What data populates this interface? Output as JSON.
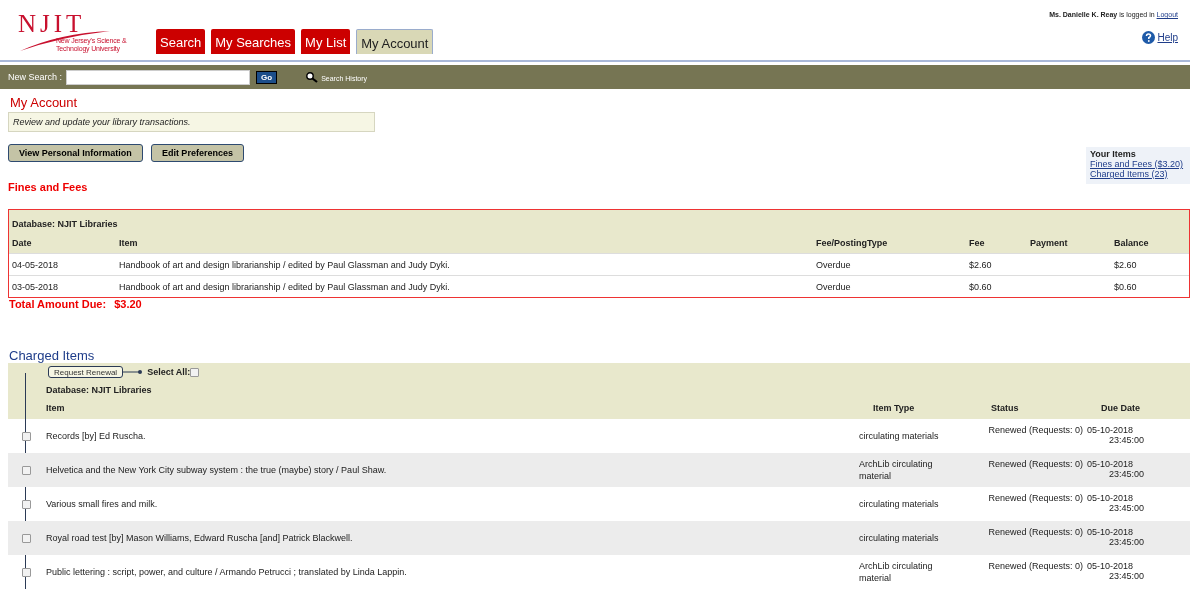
{
  "header": {
    "logo": {
      "name": "NJIT",
      "tagline_1": "New Jersey's Science &",
      "tagline_2": "Technology University"
    },
    "user": {
      "name": "Ms. Danielle K. Reay",
      "status": "is logged in",
      "logout": "Logout"
    },
    "help": "Help"
  },
  "tabs": [
    {
      "label": "Search",
      "selected": false
    },
    {
      "label": "My Searches",
      "selected": false
    },
    {
      "label": "My List",
      "selected": false
    },
    {
      "label": "My Account",
      "selected": true
    }
  ],
  "search_bar": {
    "label": "New Search :",
    "button": "Go",
    "history": "Search History"
  },
  "page": {
    "title": "My Account",
    "description": "Review and update your library transactions.",
    "buttons": [
      "View Personal Information",
      "Edit Preferences"
    ]
  },
  "your_items": {
    "title": "Your Items",
    "links": [
      "Fines and Fees ($3.20)",
      "Charged Items (23)"
    ]
  },
  "fines": {
    "title": "Fines and Fees",
    "database": "Database: NJIT Libraries",
    "columns": [
      "Date",
      "Item",
      "Fee/PostingType",
      "Fee",
      "Payment",
      "Balance"
    ],
    "rows": [
      [
        "04-05-2018",
        "Handbook of art and design librarianship / edited by Paul Glassman and Judy Dyki.",
        "Overdue",
        "$2.60",
        "",
        "$2.60"
      ],
      [
        "03-05-2018",
        "Handbook of art and design librarianship / edited by Paul Glassman and Judy Dyki.",
        "Overdue",
        "$0.60",
        "",
        "$0.60"
      ]
    ],
    "total_label": "Total Amount Due:",
    "total": "$3.20"
  },
  "charged": {
    "title": "Charged Items",
    "renew_button": "Request Renewal",
    "select_all": {
      "label": "Select All:",
      "checked": false
    },
    "database": "Database: NJIT Libraries",
    "columns": [
      "Item",
      "Item Type",
      "Status",
      "Due Date"
    ],
    "rows": [
      {
        "checked": false,
        "item": "Records [by] Ed Ruscha.",
        "type": "circulating materials",
        "status": "Renewed (Requests: 0)",
        "due_date": "05-10-2018",
        "due_time": "23:45:00"
      },
      {
        "checked": false,
        "item": "Helvetica and the New York City subway system : the true (maybe) story / Paul Shaw.",
        "type": "ArchLib circulating material",
        "status": "Renewed (Requests: 0)",
        "due_date": "05-10-2018",
        "due_time": "23:45:00"
      },
      {
        "checked": false,
        "item": "Various small fires and milk.",
        "type": "circulating materials",
        "status": "Renewed (Requests: 0)",
        "due_date": "05-10-2018",
        "due_time": "23:45:00"
      },
      {
        "checked": false,
        "item": "Royal road test [by] Mason Williams, Edward Ruscha [and] Patrick Blackwell.",
        "type": "circulating materials",
        "status": "Renewed (Requests: 0)",
        "due_date": "05-10-2018",
        "due_time": "23:45:00"
      },
      {
        "checked": false,
        "item": "Public lettering : script, power, and culture / Armando Petrucci ; translated by Linda Lappin.",
        "type": "ArchLib circulating material",
        "status": "Renewed (Requests: 0)",
        "due_date": "05-10-2018",
        "due_time": "23:45:00"
      }
    ]
  }
}
